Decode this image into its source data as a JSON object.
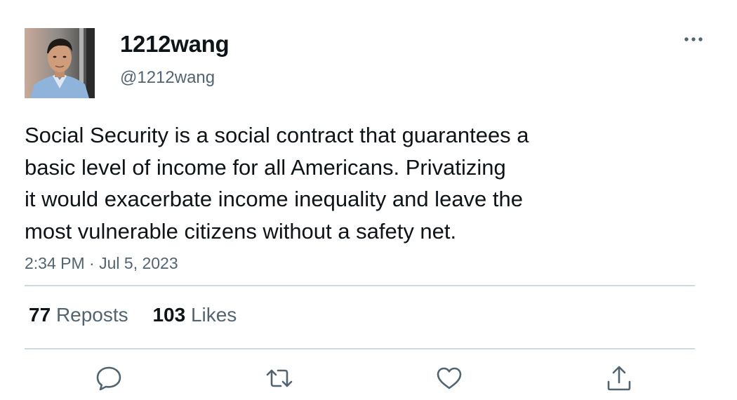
{
  "user": {
    "display_name": "1212wang",
    "handle": "@1212wang"
  },
  "tweet": {
    "text_lines": [
      "Social Security is a social contract that guarantees a",
      "basic level of income for all Americans. Privatizing",
      "it would exacerbate income inequality and leave the",
      "most vulnerable citizens without a safety net."
    ],
    "time": "2:34 PM",
    "separator": "·",
    "date": "Jul 5, 2023"
  },
  "stats": {
    "reposts_count": "77",
    "reposts_label": "Reposts",
    "likes_count": "103",
    "likes_label": "Likes"
  },
  "icons": {
    "more": "more-horizontal-icon",
    "reply": "reply-bubble-icon",
    "repost": "repost-arrows-icon",
    "like": "heart-icon",
    "share": "share-upload-icon"
  },
  "colors": {
    "text_primary": "#0f1419",
    "text_secondary": "#536471",
    "divider": "#cfd9de"
  }
}
